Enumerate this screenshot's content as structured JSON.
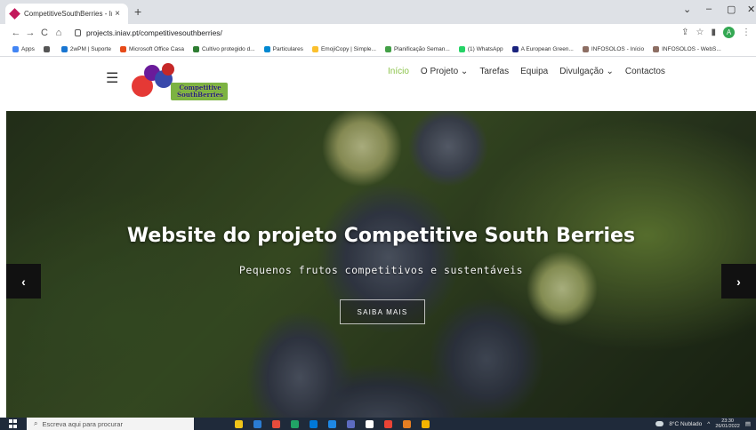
{
  "browser": {
    "tab": {
      "title": "CompetitiveSouthBerries - Início",
      "close": "×"
    },
    "new_tab": "+",
    "window_controls": {
      "dropdown": "⌄",
      "minimize": "–",
      "maximize": "▢",
      "close": "✕"
    },
    "nav": {
      "back": "←",
      "forward": "→",
      "reload": "C",
      "home": "⌂"
    },
    "url": "projects.iniav.pt/competitivesouthberries/",
    "right_icons": {
      "share": "⇪",
      "star": "☆",
      "sidebar": "▮",
      "profile": "A",
      "menu": "⋮"
    }
  },
  "bookmarks": [
    {
      "label": "Apps",
      "color": "#4285f4"
    },
    {
      "label": "",
      "color": "#555555"
    },
    {
      "label": "2wPM | Suporte",
      "color": "#1976d2"
    },
    {
      "label": "Microsoft Office Casa",
      "color": "#e64a19"
    },
    {
      "label": "Cultivo protegido d...",
      "color": "#2e7d32"
    },
    {
      "label": "Particulares",
      "color": "#0288d1"
    },
    {
      "label": "EmojiCopy | Simple...",
      "color": "#fbc02d"
    },
    {
      "label": "Planificação Seman...",
      "color": "#43a047"
    },
    {
      "label": "(1) WhatsApp",
      "color": "#25d366"
    },
    {
      "label": "A European Green...",
      "color": "#1a237e"
    },
    {
      "label": "INFOSOLOS - Início",
      "color": "#8d6e63"
    },
    {
      "label": "INFOSOLOS - WebS...",
      "color": "#8d6e63"
    }
  ],
  "site": {
    "menu_icon": "☰",
    "logo_text_line1": "Competitive",
    "logo_text_line2": "SouthBerries",
    "nav": {
      "inicio": "Início",
      "projeto": "O Projeto ⌄",
      "tarefas": "Tarefas",
      "equipa": "Equipa",
      "divulgacao": "Divulgação ⌄",
      "contactos": "Contactos"
    }
  },
  "hero": {
    "title": "Website do projeto Competitive South Berries",
    "subtitle": "Pequenos frutos competitivos e sustentáveis",
    "button": "SAIBA MAIS",
    "prev": "‹",
    "next": "›"
  },
  "taskbar": {
    "search_placeholder": "Escreva aqui para procurar",
    "apps": [
      "#f0c419",
      "#2b7cd3",
      "#e74c3c",
      "#21a366",
      "#0078d7",
      "#1e88e5",
      "#5c6bc0",
      "#ffffff",
      "#ea4335",
      "#e67e22",
      "#f4b400"
    ],
    "weather": "8°C Nublado",
    "time": "23:30",
    "date": "26/01/2022"
  }
}
